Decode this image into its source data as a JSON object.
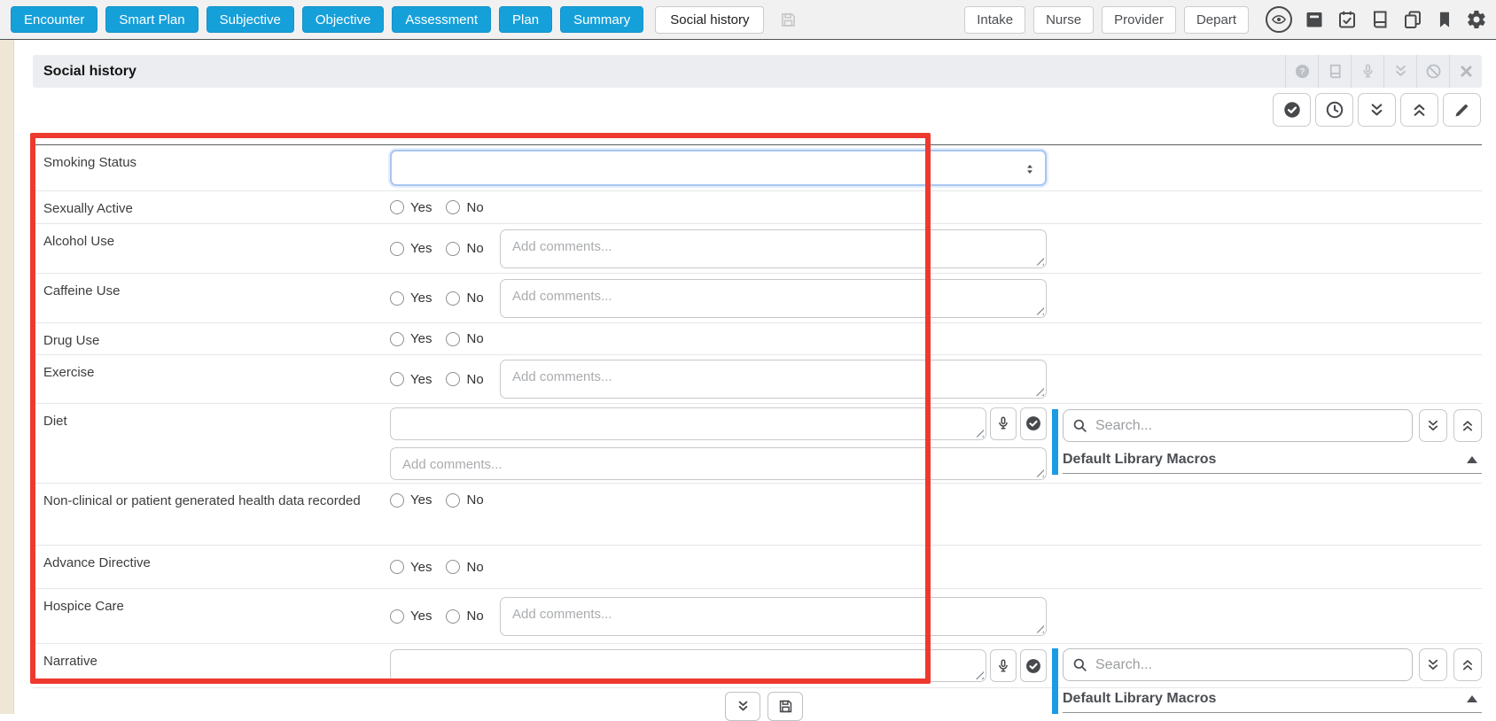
{
  "toolbar": {
    "nav_buttons": [
      "Encounter",
      "Smart Plan",
      "Subjective",
      "Objective",
      "Assessment",
      "Plan",
      "Summary"
    ],
    "active_tab": "Social history",
    "phase_buttons": [
      "Intake",
      "Nurse",
      "Provider",
      "Depart"
    ],
    "right_icon_names": [
      "eye-icon",
      "archive-icon",
      "calendar-check-icon",
      "book-icon",
      "copy-icon",
      "bookmark-icon",
      "settings-icon"
    ]
  },
  "section": {
    "title": "Social history",
    "header_icon_names": [
      "help-icon",
      "book-icon",
      "microphone-icon",
      "collapse-icon",
      "ban-icon",
      "close-icon"
    ],
    "action_icon_names": [
      "check-circle-icon",
      "clock-icon",
      "expand-all-icon",
      "collapse-all-icon",
      "edit-icon"
    ]
  },
  "form": {
    "yes_label": "Yes",
    "no_label": "No",
    "comments_placeholder": "Add comments...",
    "smoking_status_value": "",
    "rows": [
      {
        "label": "Smoking Status"
      },
      {
        "label": "Sexually Active"
      },
      {
        "label": "Alcohol Use"
      },
      {
        "label": "Caffeine Use"
      },
      {
        "label": "Drug Use"
      },
      {
        "label": "Exercise"
      },
      {
        "label": "Diet"
      },
      {
        "label": "Non-clinical or patient generated health data recorded"
      },
      {
        "label": "Advance Directive"
      },
      {
        "label": "Hospice Care"
      },
      {
        "label": "Narrative"
      }
    ]
  },
  "macros_panel": {
    "search_placeholder": "Search...",
    "title": "Default Library Macros"
  },
  "colors": {
    "accent_blue": "#16a0da",
    "panel_bar_blue": "#1b9ce3",
    "annotation_red": "#ee392f",
    "toolbar_bg": "#f1f1f2",
    "section_header_bg": "#ebedf0",
    "left_strip_beige": "#eee7d5"
  }
}
